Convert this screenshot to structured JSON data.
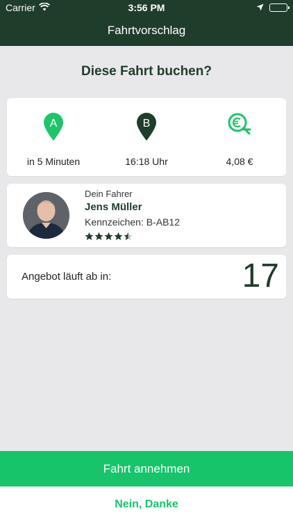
{
  "status_bar": {
    "carrier": "Carrier",
    "time": "3:56 PM",
    "icons": [
      "wifi-icon",
      "location-arrow-icon",
      "battery-icon"
    ]
  },
  "nav": {
    "title": "Fahrtvorschlag"
  },
  "heading": "Diese Fahrt buchen?",
  "trip": {
    "pickup": {
      "marker_letter": "A",
      "value": "in 5 Minuten",
      "icon": "pin-a-icon",
      "color": "#1ec36a"
    },
    "arrival": {
      "marker_letter": "B",
      "value": "16:18 Uhr",
      "icon": "pin-b-icon",
      "color": "#1e3d2b"
    },
    "price": {
      "value": "4,08 €",
      "icon": "euro-coin-icon",
      "color": "#1ec36a"
    }
  },
  "driver": {
    "caption": "Dein Fahrer",
    "name": "Jens Müller",
    "plate": "Kennzeichen: B-AB12",
    "rating": 4.5,
    "rating_max": 5
  },
  "offer": {
    "label": "Angebot läuft ab in:",
    "countdown": "17"
  },
  "actions": {
    "accept": "Fahrt annehmen",
    "decline": "Nein, Danke"
  },
  "colors": {
    "dark_green": "#1e3d2b",
    "accent_green": "#18c46a",
    "background": "#e8e8ea"
  }
}
